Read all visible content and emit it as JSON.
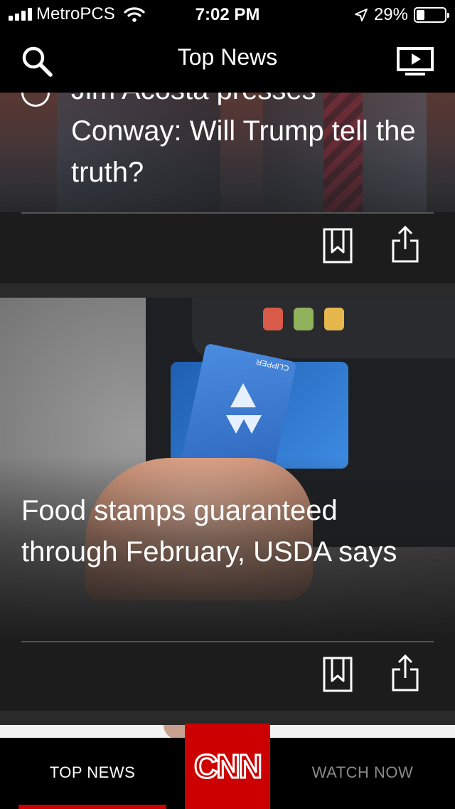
{
  "status_bar": {
    "carrier": "MetroPCS",
    "time": "7:02 PM",
    "battery_percent": "29%",
    "battery_level": 0.29,
    "icons": [
      "signal-bars-icon",
      "wifi-icon",
      "location-arrow-icon",
      "battery-icon"
    ]
  },
  "header": {
    "title": "Top News",
    "search_icon": "search-icon",
    "watch_icon": "tv-play-icon"
  },
  "feed": {
    "items": [
      {
        "title_visible": "Conway: Will Trump tell the truth?",
        "partial_line": "Jim Acosta presses",
        "has_video": true,
        "actions": [
          "bookmark-icon",
          "share-icon"
        ]
      },
      {
        "title": "Food stamps guaranteed through February, USDA says",
        "image_text": "CLIPPER",
        "actions": [
          "bookmark-icon",
          "share-icon"
        ]
      }
    ]
  },
  "tabbar": {
    "top_news_label": "TOP NEWS",
    "logo_text": "CNN",
    "watch_now_label": "WATCH NOW",
    "active": "TOP NEWS",
    "accent": "#cc0000"
  }
}
